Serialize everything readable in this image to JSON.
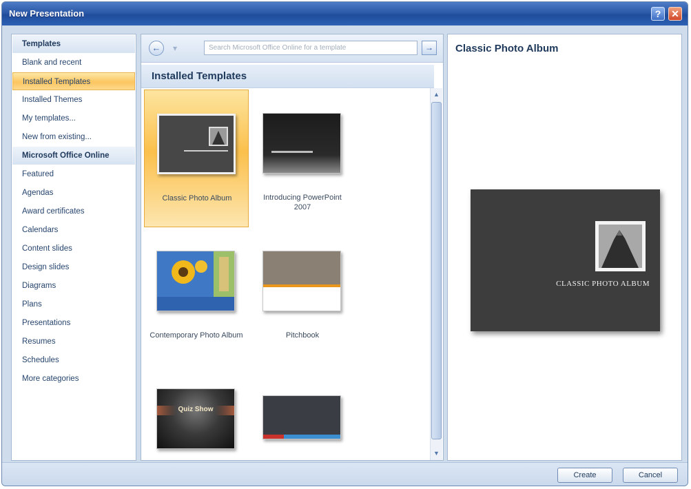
{
  "window": {
    "title": "New Presentation"
  },
  "left_nav": {
    "items": [
      {
        "label": "Templates",
        "kind": "header"
      },
      {
        "label": "Blank and recent"
      },
      {
        "label": "Installed Templates",
        "selected": true
      },
      {
        "label": "Installed Themes"
      },
      {
        "label": "My templates..."
      },
      {
        "label": "New from existing..."
      },
      {
        "label": "Microsoft Office Online",
        "kind": "header"
      },
      {
        "label": "Featured"
      },
      {
        "label": "Agendas"
      },
      {
        "label": "Award certificates"
      },
      {
        "label": "Calendars"
      },
      {
        "label": "Content slides"
      },
      {
        "label": "Design slides"
      },
      {
        "label": "Diagrams"
      },
      {
        "label": "Plans"
      },
      {
        "label": "Presentations"
      },
      {
        "label": "Resumes"
      },
      {
        "label": "Schedules"
      },
      {
        "label": "More categories"
      }
    ]
  },
  "search": {
    "placeholder": "Search Microsoft Office Online for a template"
  },
  "gallery": {
    "heading": "Installed Templates",
    "templates": [
      {
        "label": "Classic Photo Album",
        "selected": true
      },
      {
        "label": "Introducing PowerPoint 2007"
      },
      {
        "label": "Contemporary Photo Album"
      },
      {
        "label": "Pitchbook"
      },
      {
        "label": "Quiz Show"
      },
      {
        "label": ""
      }
    ],
    "thumb_text": {
      "quiz_show": "Quiz Show"
    }
  },
  "preview": {
    "title": "Classic Photo Album",
    "slide_caption": "CLASSIC PHOTO ALBUM"
  },
  "buttons": {
    "create": "Create",
    "cancel": "Cancel"
  },
  "colors": {
    "title_bar": "#2c5aa8",
    "selection": "#fcc560",
    "dialog_bg": "#cfdcec"
  }
}
